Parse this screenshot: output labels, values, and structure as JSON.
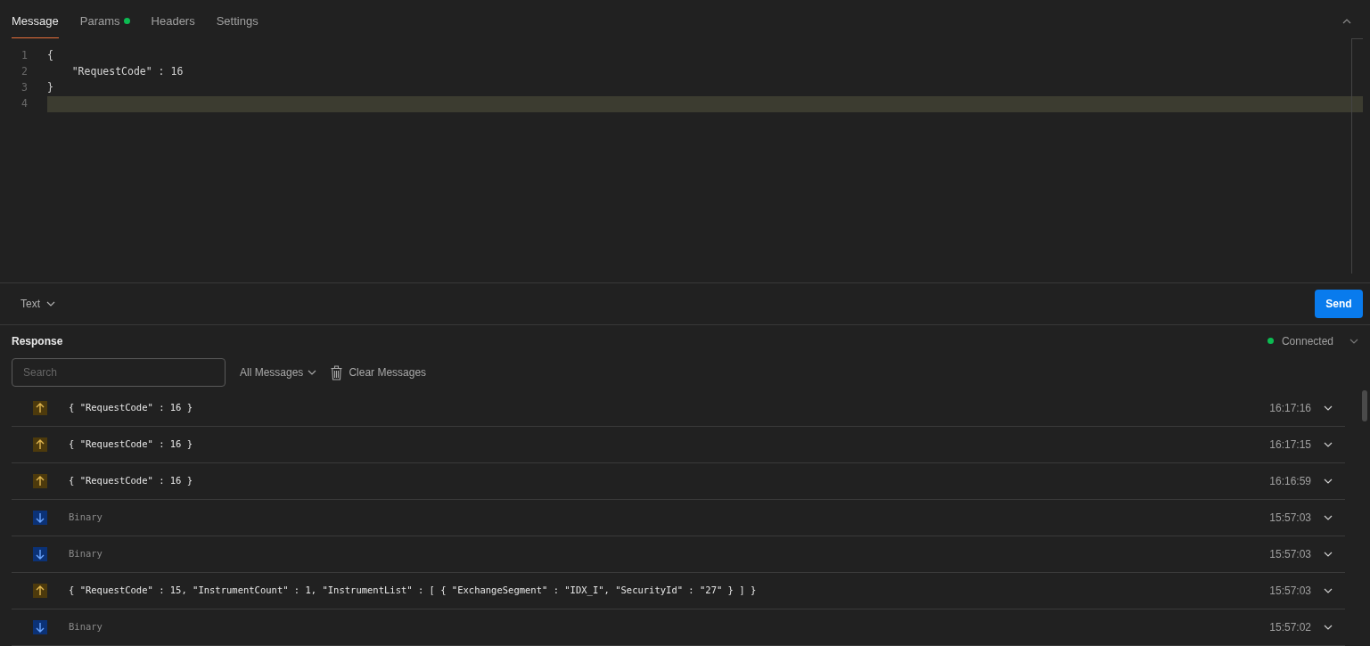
{
  "tabs": [
    {
      "label": "Message",
      "selected": true,
      "indicator": false
    },
    {
      "label": "Params",
      "selected": false,
      "indicator": true
    },
    {
      "label": "Headers",
      "selected": false,
      "indicator": false
    },
    {
      "label": "Settings",
      "selected": false,
      "indicator": false
    }
  ],
  "editor": {
    "lines": [
      {
        "number": "1",
        "code": "{",
        "current": false
      },
      {
        "number": "2",
        "code": "    \"RequestCode\" : 16",
        "current": false
      },
      {
        "number": "3",
        "code": "}",
        "current": false
      },
      {
        "number": "4",
        "current": true
      }
    ]
  },
  "format": {
    "label": "Text"
  },
  "send_button": "Send",
  "response": {
    "title": "Response",
    "status": {
      "label": "Connected",
      "connected": true
    },
    "search": {
      "placeholder": "Search"
    },
    "filter": "All Messages",
    "clear": "Clear Messages",
    "messages": [
      {
        "kind": "sent",
        "text": "{ \"RequestCode\" : 16 }",
        "time": "16:17:16"
      },
      {
        "kind": "sent",
        "text": "{ \"RequestCode\" : 16 }",
        "time": "16:17:15"
      },
      {
        "kind": "sent",
        "text": "{ \"RequestCode\" : 16 }",
        "time": "16:16:59"
      },
      {
        "kind": "received",
        "text": "Binary",
        "time": "15:57:03"
      },
      {
        "kind": "received",
        "text": "Binary",
        "time": "15:57:03"
      },
      {
        "kind": "sent",
        "text": "{ \"RequestCode\" : 15, \"InstrumentCount\" : 1, \"InstrumentList\" : [ { \"ExchangeSegment\" : \"IDX_I\", \"SecurityId\" : \"27\" } ] }",
        "time": "15:57:03"
      },
      {
        "kind": "received",
        "text": "Binary",
        "time": "15:57:02"
      }
    ]
  }
}
